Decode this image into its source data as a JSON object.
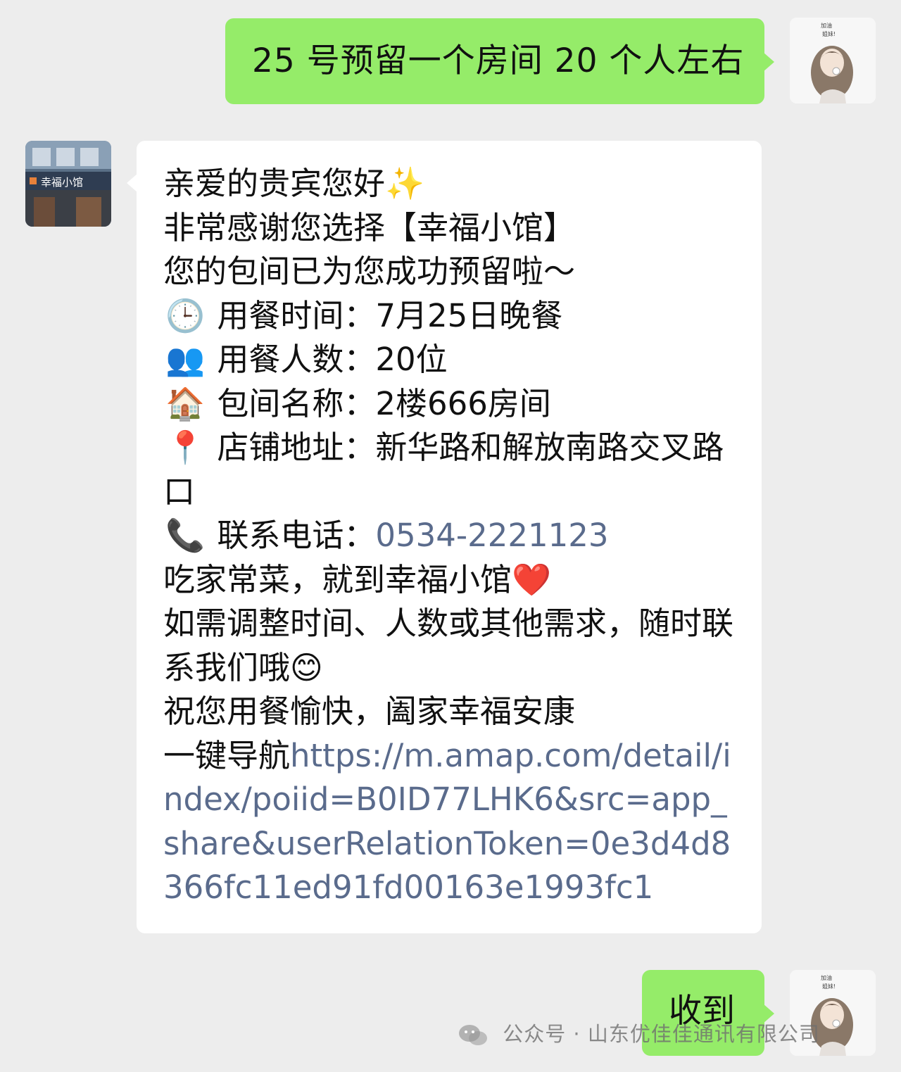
{
  "messages": [
    {
      "sender": "me",
      "text": "25 号预留一个房间 20 个人左右"
    },
    {
      "sender": "shop",
      "lines": {
        "greeting": "亲爱的贵宾您好",
        "greeting_emoji": "✨",
        "thanks": "非常感谢您选择【幸福小馆】",
        "reserved": "您的包间已为您成功预留啦～",
        "time": {
          "icon": "🕒",
          "text": "用餐时间：7月25日晚餐"
        },
        "people": {
          "icon": "👥",
          "text": "用餐人数：20位"
        },
        "room": {
          "icon": "🏠",
          "text": "包间名称：2楼666房间"
        },
        "address": {
          "icon": "📍",
          "text": "店铺地址：新华路和解放南路交叉路口"
        },
        "phone": {
          "icon": "📞",
          "label": "联系电话：",
          "number": "0534-2221123"
        },
        "slogan": " 吃家常菜，就到幸福小馆",
        "slogan_emoji": "❤️",
        "adjust": "如需调整时间、人数或其他需求，随时联系我们哦",
        "adjust_emoji": "😊",
        "wish": "祝您用餐愉快，阖家幸福安康",
        "nav_label": "一键导航",
        "nav_url": "https://m.amap.com/detail/index/poiid=B0ID77LHK6&src=app_share&userRelationToken=0e3d4d8366fc11ed91fd00163e1993fc1"
      }
    },
    {
      "sender": "me",
      "text": "收到"
    }
  ],
  "shop_avatar_sign": "幸福小馆",
  "watermark": "公众号 · 山东优佳佳通讯有限公司",
  "colors": {
    "background": "#ededed",
    "my_bubble": "#95ec69",
    "their_bubble": "#ffffff",
    "link": "#5a6b8c"
  }
}
